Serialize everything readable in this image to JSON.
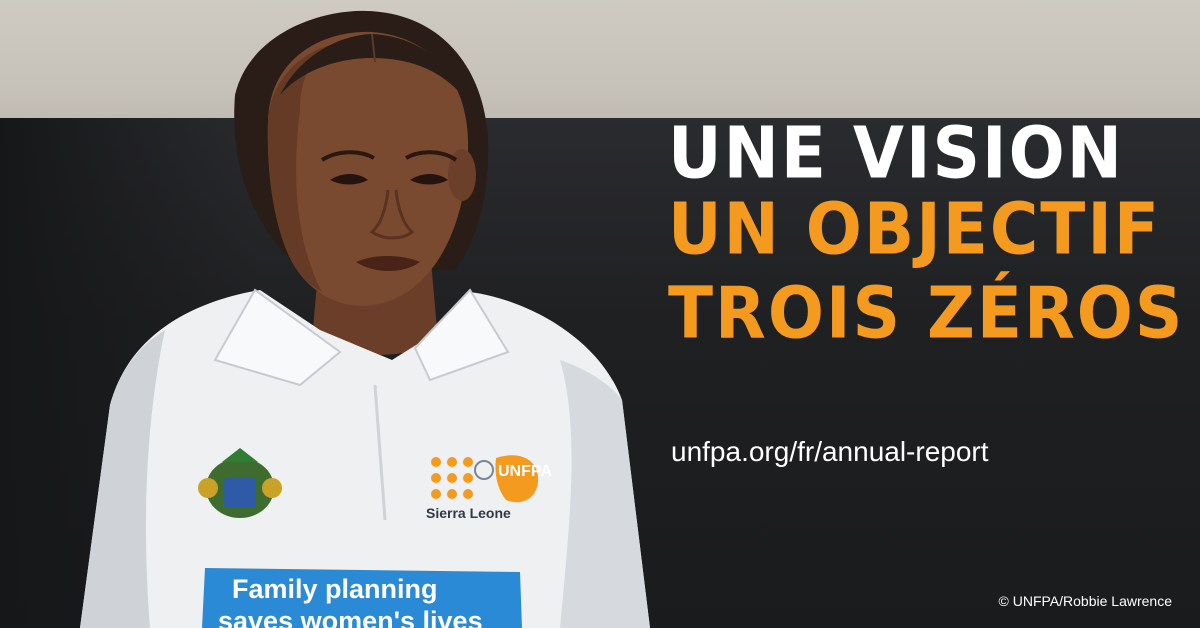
{
  "headline": {
    "line1": "UNE VISION",
    "line2": "UN OBJECTIF",
    "line3": "TROIS ZÉROS"
  },
  "url": "unfpa.org/fr/annual-report",
  "credit": "© UNFPA/Robbie Lawrence",
  "shirt": {
    "banner_line1": "Family planning",
    "banner_line2": "saves women's lives",
    "logo_name": "UNFPA",
    "logo_country": "Sierra Leone"
  },
  "colors": {
    "headline_white": "#ffffff",
    "headline_orange": "#f39a1f",
    "shirt_banner": "#2b8ad6",
    "logo_orange": "#f39a1f"
  }
}
